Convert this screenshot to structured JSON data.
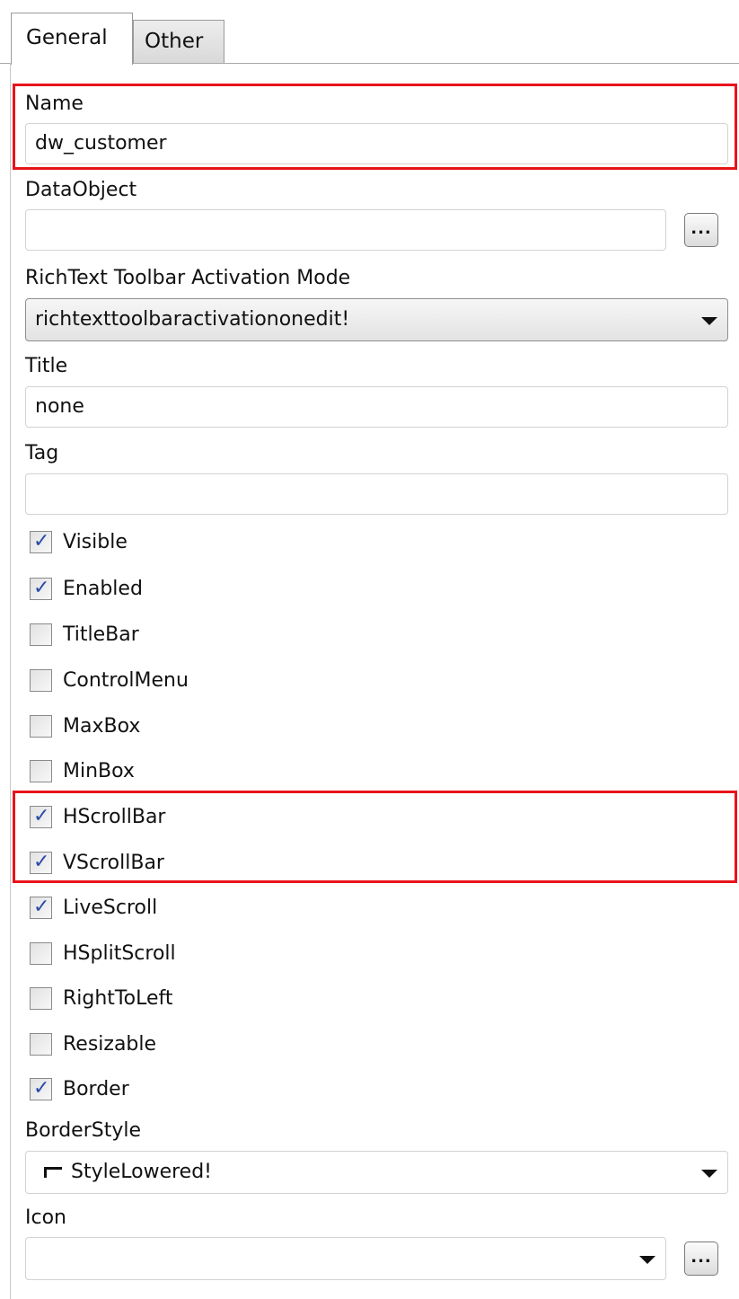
{
  "tabs": {
    "general": "General",
    "other": "Other"
  },
  "name": {
    "label": "Name",
    "value": "dw_customer"
  },
  "dataobject": {
    "label": "DataObject",
    "value": "",
    "browse": "..."
  },
  "richtext": {
    "label": "RichText Toolbar Activation Mode",
    "value": "richtexttoolbaractivationonedit!"
  },
  "title": {
    "label": "Title",
    "value": "none"
  },
  "tag": {
    "label": "Tag",
    "value": ""
  },
  "checkboxes": [
    {
      "label": "Visible",
      "checked": true
    },
    {
      "label": "Enabled",
      "checked": true
    },
    {
      "label": "TitleBar",
      "checked": false
    },
    {
      "label": "ControlMenu",
      "checked": false
    },
    {
      "label": "MaxBox",
      "checked": false
    },
    {
      "label": "MinBox",
      "checked": false
    },
    {
      "label": "HScrollBar",
      "checked": true
    },
    {
      "label": "VScrollBar",
      "checked": true
    },
    {
      "label": "LiveScroll",
      "checked": true
    },
    {
      "label": "HSplitScroll",
      "checked": false
    },
    {
      "label": "RightToLeft",
      "checked": false
    },
    {
      "label": "Resizable",
      "checked": false
    },
    {
      "label": "Border",
      "checked": true
    }
  ],
  "borderstyle": {
    "label": "BorderStyle",
    "value": "StyleLowered!"
  },
  "icon": {
    "label": "Icon",
    "value": "",
    "browse": "..."
  },
  "colors": {
    "highlight": "#e8141a",
    "check": "#2b4aa8"
  }
}
